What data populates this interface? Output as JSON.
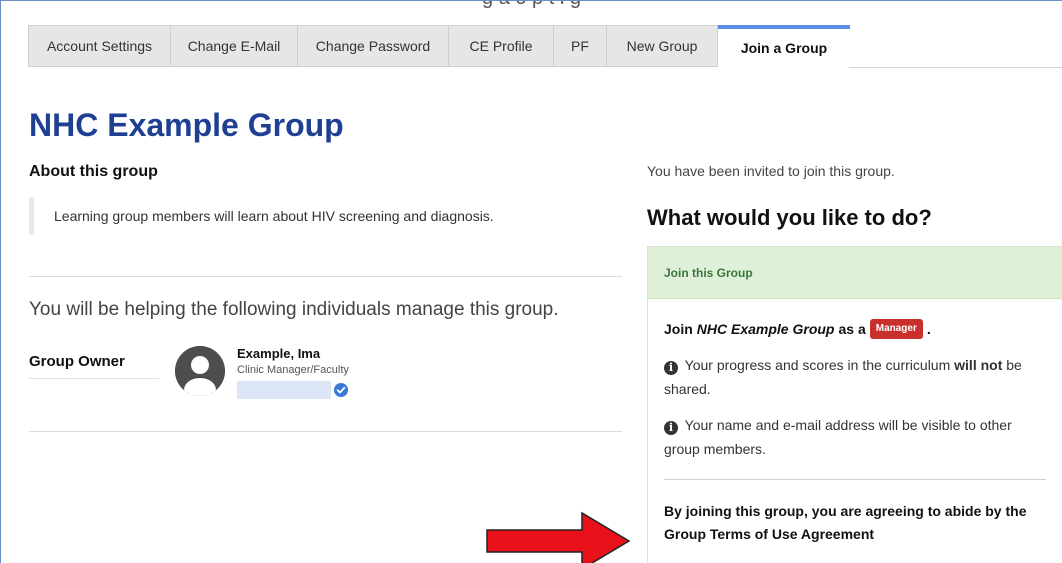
{
  "tabs": [
    {
      "label": "Account Settings",
      "active": false
    },
    {
      "label": "Change E-Mail",
      "active": false
    },
    {
      "label": "Change Password",
      "active": false
    },
    {
      "label": "CE Profile",
      "active": false
    },
    {
      "label": "PF",
      "active": false
    },
    {
      "label": "New Group",
      "active": false
    },
    {
      "label": "Join a Group",
      "active": true
    }
  ],
  "top_banner_partial": "g a   o p   t i g",
  "group": {
    "title": "NHC Example Group",
    "about_heading": "About this group",
    "description": "Learning group members will learn about HIV screening and diagnosis.",
    "helping_text": "You will be helping the following individuals manage this group.",
    "owner_label": "Group Owner",
    "owner": {
      "name": "Example, Ima",
      "role": "Clinic Manager/Faculty"
    }
  },
  "invite": {
    "invited_text": "You have been invited to join this group.",
    "question": "What would you like to do?",
    "panel_title": "Join this Group",
    "join_prefix": "Join",
    "join_group_name": "NHC Example Group",
    "join_as": "as a",
    "role_badge": "Manager",
    "join_suffix": ".",
    "note1_pre": "Your progress and scores in the curriculum",
    "note1_bold": "will not",
    "note1_post": "be shared.",
    "note2": "Your name and e-mail address will be visible to other group members.",
    "agreement": "By joining this group, you are agreeing to abide by the Group Terms of Use Agreement"
  },
  "colors": {
    "title_blue": "#1f3f92",
    "active_tab_accent": "#5b8ee0",
    "panel_header_bg": "#dff0d8",
    "panel_header_text": "#3c763d",
    "badge_red": "#c9302c",
    "annotation_arrow": "#e8101a"
  },
  "icons": {
    "avatar": "user-silhouette-icon",
    "verified": "check-circle-icon",
    "info": "info-circle-icon",
    "annotation": "red-arrow-icon"
  }
}
